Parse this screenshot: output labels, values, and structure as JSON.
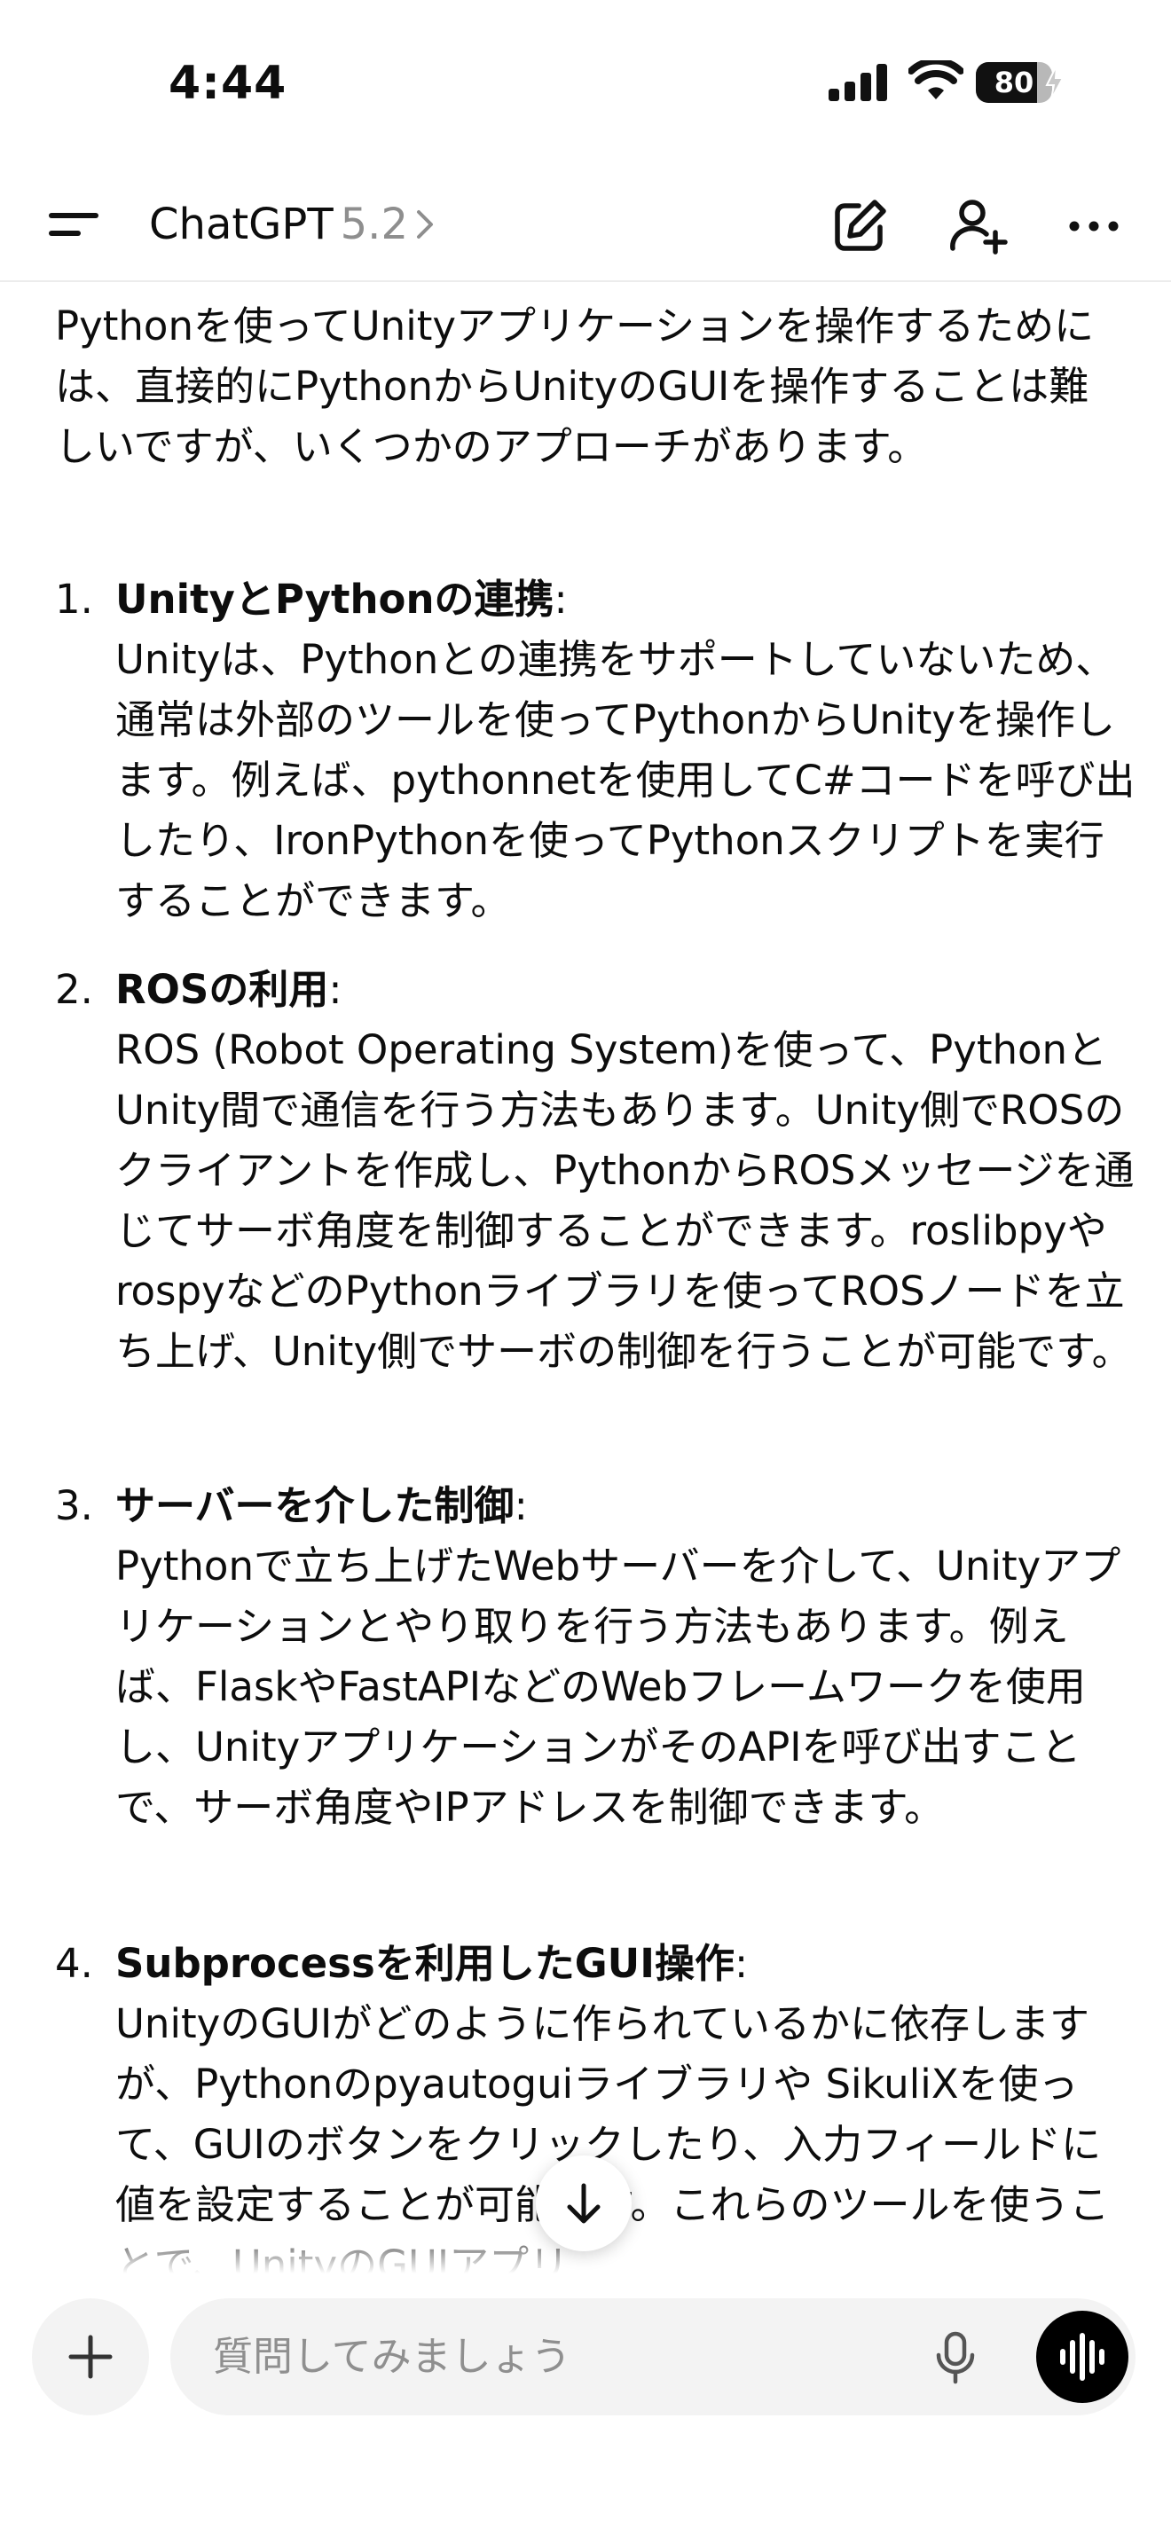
{
  "status_bar": {
    "time": "4:44",
    "battery_text": "80",
    "battery_level": 0.8,
    "icons": [
      "cellular-signal-icon",
      "wifi-icon",
      "battery-icon",
      "charging-bolt-icon"
    ]
  },
  "header": {
    "title": "ChatGPT",
    "version": "5.2",
    "icons": [
      "menu-icon",
      "chevron-right-icon",
      "new-chat-icon",
      "add-person-icon",
      "more-icon"
    ]
  },
  "message": {
    "intro": "Pythonを使ってUnityアプリケーションを操作するためには、直接的にPythonからUnityのGUIを操作することは難しいですが、いくつかのアプローチがあります。",
    "items": [
      {
        "number": "1.",
        "title": "UnityとPythonの連携",
        "colon": ":",
        "body": "Unityは、Pythonとの連携をサポートしていないため、通常は外部のツールを使ってPythonからUnityを操作します。例えば、pythonnetを使用してC#コードを呼び出したり、IronPythonを使ってPythonスクリプトを実行することができます。"
      },
      {
        "number": "2.",
        "title": "ROSの利用",
        "colon": ":",
        "body": "ROS (Robot Operating System)を使って、PythonとUnity間で通信を行う方法もあります。Unity側でROSのクライアントを作成し、PythonからROSメッセージを通じてサーボ角度を制御することができます。roslibpyやrospyなどのPythonライブラリを使ってROSノードを立ち上げ、Unity側でサーボの制御を行うことが可能です。"
      },
      {
        "number": "3.",
        "title": "サーバーを介した制御",
        "colon": ":",
        "body": "Pythonで立ち上げたWebサーバーを介して、Unityアプリケーションとやり取りを行う方法もあります。例えば、FlaskやFastAPIなどのWebフレームワークを使用し、UnityアプリケーションがそのAPIを呼び出すことで、サーボ角度やIPアドレスを制御できます。"
      },
      {
        "number": "4.",
        "title": "Subprocessを利用したGUI操作",
        "colon": ":",
        "body": "UnityのGUIがどのように作られているかに依存しますが、Pythonのpyautoguiライブラリや SikuliXを使って、GUIのボタンをクリックしたり、入力フィールドに値を設定することが可能です。これらのツールを使うことで、UnityのGUIアプリ"
      }
    ]
  },
  "composer": {
    "placeholder": "質問してみましょう",
    "icons": [
      "plus-icon",
      "microphone-icon",
      "voice-mode-icon",
      "arrow-down-icon"
    ]
  }
}
